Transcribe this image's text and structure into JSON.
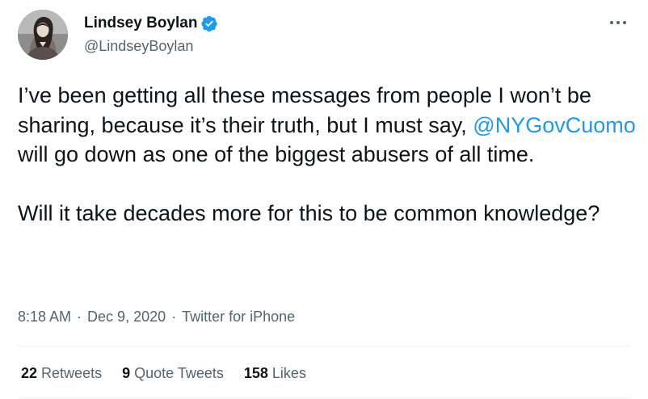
{
  "author": {
    "display_name": "Lindsey Boylan",
    "handle": "@LindseyBoylan",
    "verified": true
  },
  "tweet": {
    "paragraphs": [
      {
        "before": "I’ve been getting all these messages from people I won’t be sharing, because it’s their truth, but I must say, ",
        "mention": "@NYGovCuomo",
        "after": " will go down as one of the biggest abusers of all time."
      },
      {
        "text": "Will it take decades more for this to be common knowledge?"
      }
    ]
  },
  "meta": {
    "time": "8:18 AM",
    "separator": "·",
    "date": "Dec 9, 2020",
    "source": "Twitter for iPhone"
  },
  "stats": {
    "retweets": {
      "count": "22",
      "label": "Retweets"
    },
    "quote_tweets": {
      "count": "9",
      "label": "Quote Tweets"
    },
    "likes": {
      "count": "158",
      "label": "Likes"
    }
  },
  "icons": {
    "more": "more-options-icon",
    "verified": "verified-badge-icon"
  },
  "colors": {
    "link": "#1d9bf0",
    "secondary_text": "#536471",
    "primary_text": "#0f1419"
  }
}
